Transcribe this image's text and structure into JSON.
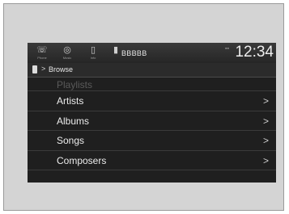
{
  "status_bar": {
    "icons": [
      {
        "name": "phone-icon",
        "glyph": "☏",
        "caption": "Phone"
      },
      {
        "name": "music-icon",
        "glyph": "◎",
        "caption": "Music"
      },
      {
        "name": "info-icon",
        "glyph": "▯",
        "caption": "Info"
      },
      {
        "name": "device-icon",
        "glyph": "▮",
        "caption": ""
      }
    ],
    "device_name": "BBBBB",
    "clock": "12:34"
  },
  "breadcrumb": {
    "arrow": ">",
    "label": "Browse"
  },
  "menu": {
    "items": [
      {
        "label": "Playlists",
        "chevron": ""
      },
      {
        "label": "Artists",
        "chevron": ">"
      },
      {
        "label": "Albums",
        "chevron": ">"
      },
      {
        "label": "Songs",
        "chevron": ">"
      },
      {
        "label": "Composers",
        "chevron": ">"
      }
    ]
  }
}
